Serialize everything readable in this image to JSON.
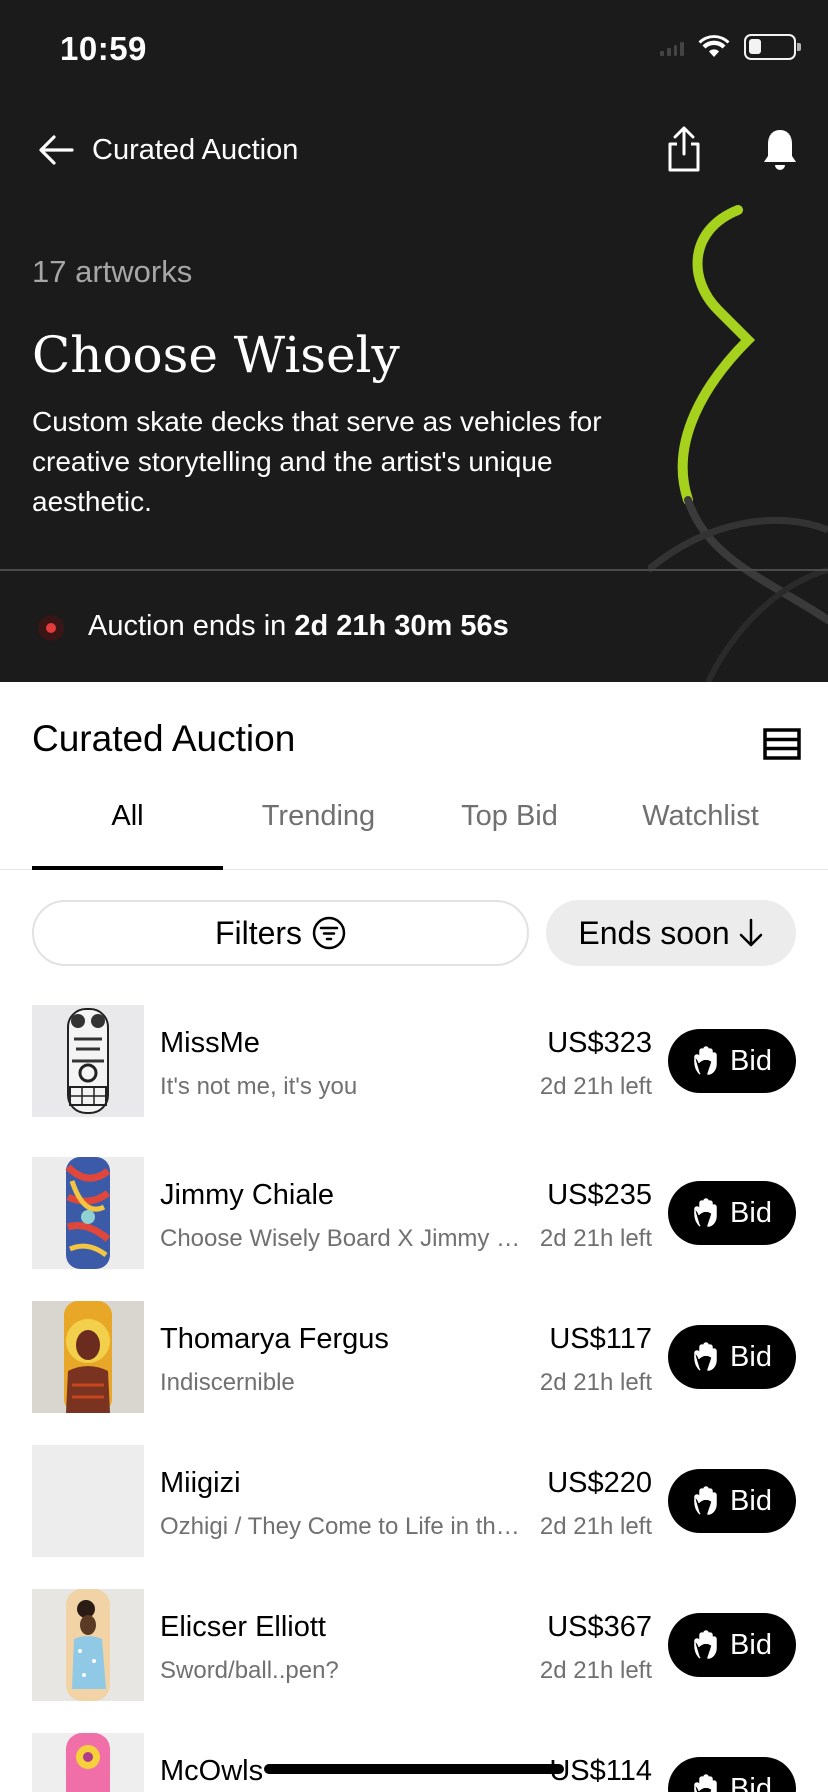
{
  "status_bar": {
    "time": "10:59",
    "battery_level": 0.28
  },
  "nav": {
    "title": "Curated Auction"
  },
  "hero": {
    "artwork_count": "17 artworks",
    "title": "Choose Wisely",
    "description": "Custom skate decks that serve as vehicles for creative storytelling and the artist's unique aesthetic.",
    "countdown_prefix": "Auction ends in ",
    "countdown_value": "2d 21h 30m 56s",
    "accent_color": "#a6d21e",
    "live_color": "#e23b3b"
  },
  "section": {
    "title": "Curated Auction"
  },
  "tabs": [
    {
      "label": "All",
      "active": true
    },
    {
      "label": "Trending",
      "active": false
    },
    {
      "label": "Top Bid",
      "active": false
    },
    {
      "label": "Watchlist",
      "active": false
    }
  ],
  "filters": {
    "filters_label": "Filters",
    "sort_label": "Ends soon"
  },
  "lots": [
    {
      "artist": "MissMe",
      "title": "It's not me, it's you",
      "price": "US$323",
      "time_left": "2d 21h left",
      "bid_label": "Bid"
    },
    {
      "artist": "Jimmy Chiale",
      "title": "Choose Wisely Board X Jimmy Chiale",
      "price": "US$235",
      "time_left": "2d 21h left",
      "bid_label": "Bid"
    },
    {
      "artist": "Thomarya Fergus",
      "title": "Indiscernible",
      "price": "US$117",
      "time_left": "2d 21h left",
      "bid_label": "Bid"
    },
    {
      "artist": "Miigizi",
      "title": "Ozhigi / They Come to Life in the Spring",
      "price": "US$220",
      "time_left": "2d 21h left",
      "bid_label": "Bid"
    },
    {
      "artist": "Elicser Elliott",
      "title": "Sword/ball..pen?",
      "price": "US$367",
      "time_left": "2d 21h left",
      "bid_label": "Bid"
    },
    {
      "artist": "McOwls",
      "title": "",
      "price": "US$114",
      "time_left": "",
      "bid_label": "Bid"
    }
  ]
}
